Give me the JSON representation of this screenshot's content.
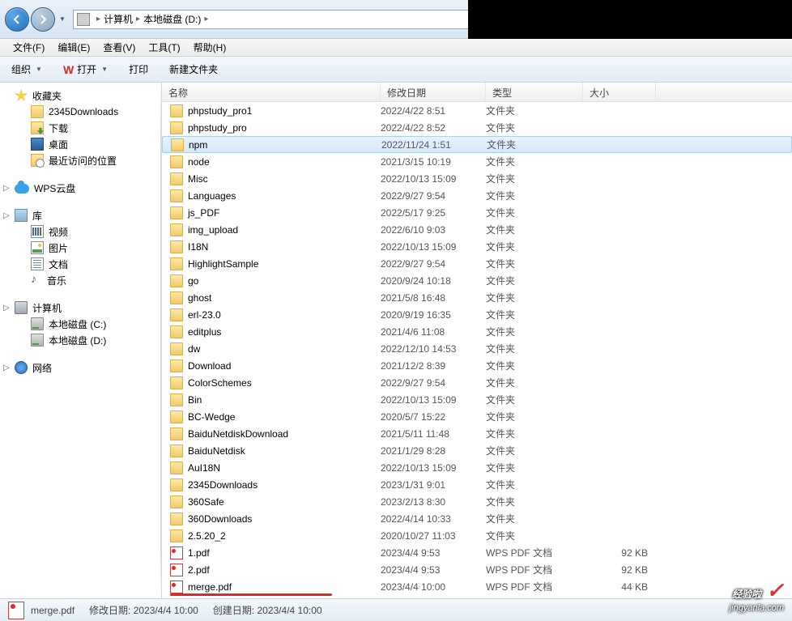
{
  "address": {
    "segments": [
      "计算机",
      "本地磁盘 (D:)"
    ]
  },
  "menubar": {
    "file": "文件(F)",
    "edit": "编辑(E)",
    "view": "查看(V)",
    "tools": "工具(T)",
    "help": "帮助(H)"
  },
  "toolbar": {
    "organize": "组织",
    "open": "打开",
    "print": "打印",
    "newfolder": "新建文件夹"
  },
  "sidebar": {
    "favorites": {
      "label": "收藏夹",
      "items": [
        {
          "label": "2345Downloads",
          "icon": "folder"
        },
        {
          "label": "下载",
          "icon": "dl"
        },
        {
          "label": "桌面",
          "icon": "desktop"
        },
        {
          "label": "最近访问的位置",
          "icon": "recent"
        }
      ]
    },
    "wps": {
      "label": "WPS云盘"
    },
    "libraries": {
      "label": "库",
      "items": [
        {
          "label": "视频",
          "icon": "video"
        },
        {
          "label": "图片",
          "icon": "pic"
        },
        {
          "label": "文档",
          "icon": "doc"
        },
        {
          "label": "音乐",
          "icon": "music"
        }
      ]
    },
    "computer": {
      "label": "计算机",
      "items": [
        {
          "label": "本地磁盘 (C:)",
          "icon": "drive"
        },
        {
          "label": "本地磁盘 (D:)",
          "icon": "drive"
        }
      ]
    },
    "network": {
      "label": "网络"
    }
  },
  "columns": {
    "name": "名称",
    "date": "修改日期",
    "type": "类型",
    "size": "大小"
  },
  "files": [
    {
      "name": "phpstudy_pro1",
      "date": "2022/4/22 8:51",
      "type": "文件夹",
      "size": "",
      "icon": "folder"
    },
    {
      "name": "phpstudy_pro",
      "date": "2022/4/22 8:52",
      "type": "文件夹",
      "size": "",
      "icon": "folder"
    },
    {
      "name": "npm",
      "date": "2022/11/24 1:51",
      "type": "文件夹",
      "size": "",
      "icon": "folder",
      "selected": true
    },
    {
      "name": "node",
      "date": "2021/3/15 10:19",
      "type": "文件夹",
      "size": "",
      "icon": "folder"
    },
    {
      "name": "Misc",
      "date": "2022/10/13 15:09",
      "type": "文件夹",
      "size": "",
      "icon": "folder"
    },
    {
      "name": "Languages",
      "date": "2022/9/27 9:54",
      "type": "文件夹",
      "size": "",
      "icon": "folder"
    },
    {
      "name": "js_PDF",
      "date": "2022/5/17 9:25",
      "type": "文件夹",
      "size": "",
      "icon": "folder"
    },
    {
      "name": "img_upload",
      "date": "2022/6/10 9:03",
      "type": "文件夹",
      "size": "",
      "icon": "folder"
    },
    {
      "name": "I18N",
      "date": "2022/10/13 15:09",
      "type": "文件夹",
      "size": "",
      "icon": "folder"
    },
    {
      "name": "HighlightSample",
      "date": "2022/9/27 9:54",
      "type": "文件夹",
      "size": "",
      "icon": "folder"
    },
    {
      "name": "go",
      "date": "2020/9/24 10:18",
      "type": "文件夹",
      "size": "",
      "icon": "folder"
    },
    {
      "name": "ghost",
      "date": "2021/5/8 16:48",
      "type": "文件夹",
      "size": "",
      "icon": "folder"
    },
    {
      "name": "erl-23.0",
      "date": "2020/9/19 16:35",
      "type": "文件夹",
      "size": "",
      "icon": "folder"
    },
    {
      "name": "editplus",
      "date": "2021/4/6 11:08",
      "type": "文件夹",
      "size": "",
      "icon": "folder"
    },
    {
      "name": "dw",
      "date": "2022/12/10 14:53",
      "type": "文件夹",
      "size": "",
      "icon": "folder"
    },
    {
      "name": "Download",
      "date": "2021/12/2 8:39",
      "type": "文件夹",
      "size": "",
      "icon": "folder"
    },
    {
      "name": "ColorSchemes",
      "date": "2022/9/27 9:54",
      "type": "文件夹",
      "size": "",
      "icon": "folder"
    },
    {
      "name": "Bin",
      "date": "2022/10/13 15:09",
      "type": "文件夹",
      "size": "",
      "icon": "folder"
    },
    {
      "name": "BC-Wedge",
      "date": "2020/5/7 15:22",
      "type": "文件夹",
      "size": "",
      "icon": "folder"
    },
    {
      "name": "BaiduNetdiskDownload",
      "date": "2021/5/11 11:48",
      "type": "文件夹",
      "size": "",
      "icon": "folder"
    },
    {
      "name": "BaiduNetdisk",
      "date": "2021/1/29 8:28",
      "type": "文件夹",
      "size": "",
      "icon": "folder"
    },
    {
      "name": "AuI18N",
      "date": "2022/10/13 15:09",
      "type": "文件夹",
      "size": "",
      "icon": "folder"
    },
    {
      "name": "2345Downloads",
      "date": "2023/1/31 9:01",
      "type": "文件夹",
      "size": "",
      "icon": "folder"
    },
    {
      "name": "360Safe",
      "date": "2023/2/13 8:30",
      "type": "文件夹",
      "size": "",
      "icon": "folder"
    },
    {
      "name": "360Downloads",
      "date": "2022/4/14 10:33",
      "type": "文件夹",
      "size": "",
      "icon": "folder"
    },
    {
      "name": "2.5.20_2",
      "date": "2020/10/27 11:03",
      "type": "文件夹",
      "size": "",
      "icon": "folder"
    },
    {
      "name": "1.pdf",
      "date": "2023/4/4 9:53",
      "type": "WPS PDF 文档",
      "size": "92 KB",
      "icon": "pdf"
    },
    {
      "name": "2.pdf",
      "date": "2023/4/4 9:53",
      "type": "WPS PDF 文档",
      "size": "92 KB",
      "icon": "pdf"
    },
    {
      "name": "merge.pdf",
      "date": "2023/4/4 10:00",
      "type": "WPS PDF 文档",
      "size": "44 KB",
      "icon": "pdf",
      "underlined": true
    }
  ],
  "statusbar": {
    "filename": "merge.pdf",
    "modified_label": "修改日期:",
    "modified_value": "2023/4/4 10:00",
    "created_label": "创建日期:",
    "created_value": "2023/4/4 10:00"
  },
  "watermark": {
    "main": "经验啦",
    "sub": "jingyanla.com"
  }
}
